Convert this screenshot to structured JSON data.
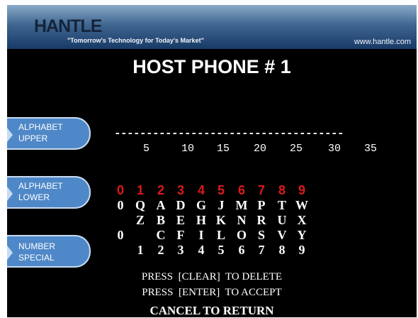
{
  "header": {
    "logo": "HANTLE",
    "tagline": "\"Tomorrow's Technology for Today's Market\"",
    "website": "www.hantle.com"
  },
  "screen_title": "HOST PHONE # 1",
  "side_buttons": [
    {
      "line1": "ALPHABET",
      "line2": "UPPER"
    },
    {
      "line1": "ALPHABET",
      "line2": "LOWER"
    },
    {
      "line1": "NUMBER",
      "line2": "SPECIAL"
    }
  ],
  "entry_line": "------------------------------------",
  "ruler": [
    "5",
    "10",
    "15",
    "20",
    "25",
    "30",
    "35"
  ],
  "keypad": {
    "digits": [
      "0",
      "1",
      "2",
      "3",
      "4",
      "5",
      "6",
      "7",
      "8",
      "9"
    ],
    "row1": [
      "0",
      "Q",
      "A",
      "D",
      "G",
      "J",
      "M",
      "P",
      "T",
      "W"
    ],
    "row2": [
      "",
      "Z",
      "B",
      "E",
      "H",
      "K",
      "N",
      "R",
      "U",
      "X"
    ],
    "row3": [
      "0",
      "",
      "C",
      "F",
      "I",
      "L",
      "O",
      "S",
      "V",
      "Y"
    ],
    "row4": [
      "",
      "1",
      "2",
      "3",
      "4",
      "5",
      "6",
      "7",
      "8",
      "9"
    ]
  },
  "instructions": {
    "clear": "PRESS  [CLEAR]  TO DELETE",
    "enter": "PRESS  [ENTER]  TO ACCEPT",
    "cancel": "CANCEL TO RETURN"
  },
  "colors": {
    "background": "#000000",
    "text": "#ffffff",
    "digit_accent": "#dd1a1a",
    "button": "#4f88c8"
  }
}
